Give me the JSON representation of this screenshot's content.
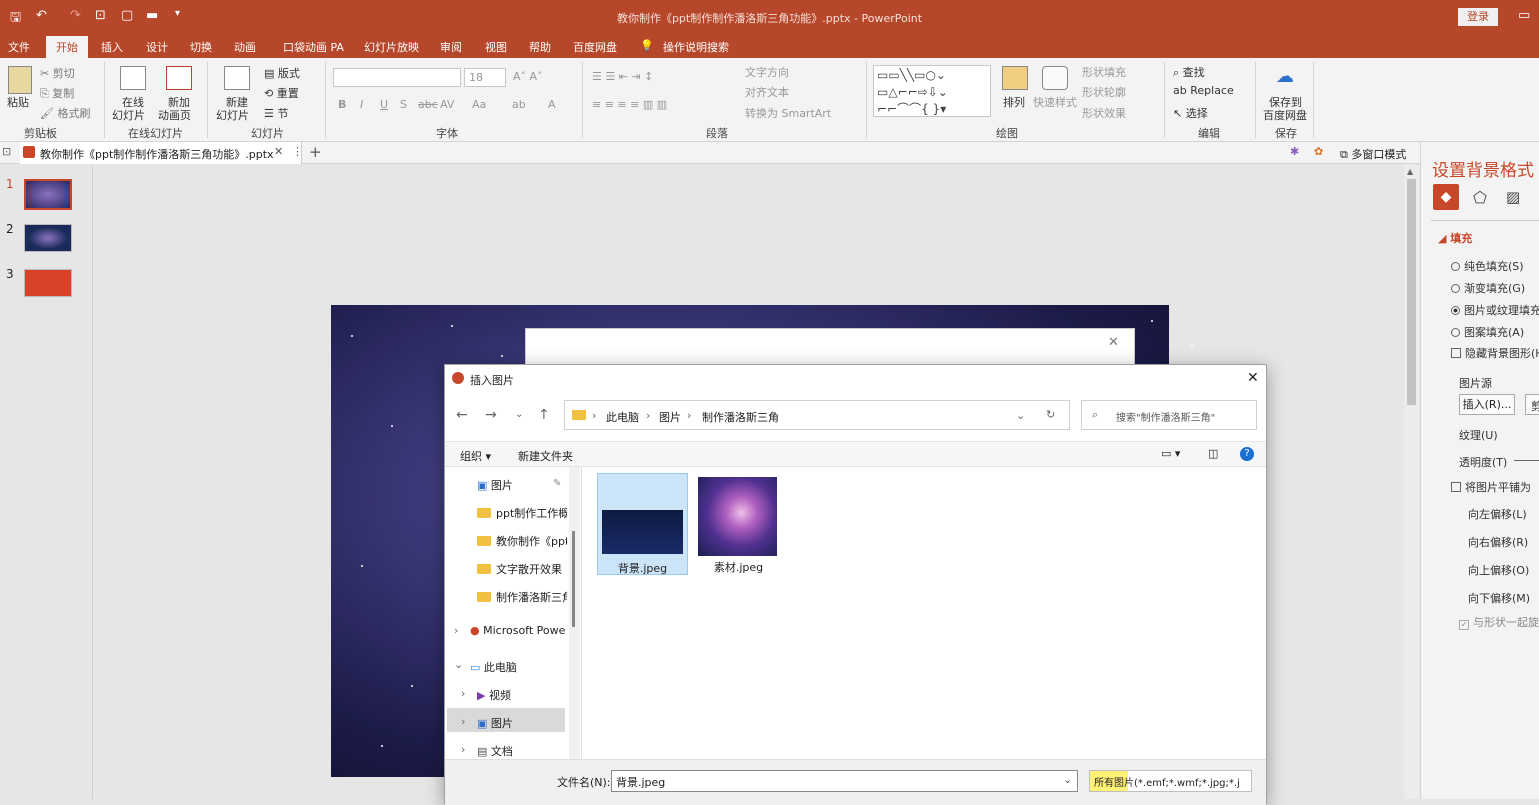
{
  "window": {
    "title": "教你制作《ppt制作制作潘洛斯三角功能》.pptx  -  PowerPoint",
    "login": "登录"
  },
  "menu": [
    "文件",
    "开始",
    "插入",
    "设计",
    "切换",
    "动画",
    "口袋动画 PA",
    "幻灯片放映",
    "审阅",
    "视图",
    "帮助",
    "百度网盘"
  ],
  "menu_search": "操作说明搜索",
  "ribbon": {
    "paste": "粘贴",
    "cut": "剪切",
    "copy": "复制",
    "format_painter": "格式刷",
    "group_clipboard": "剪贴板",
    "online_slide_1": "在线",
    "online_slide_2": "幻灯片",
    "new_anim_1": "新加",
    "new_anim_2": "动画页",
    "group_online": "在线幻灯片",
    "new_slide_1": "新建",
    "new_slide_2": "幻灯片",
    "layout": "版式",
    "reset": "重置",
    "section": "节",
    "group_slides": "幻灯片",
    "font_size": "18",
    "group_font": "字体",
    "text_direction": "文字方向",
    "align_text": "对齐文本",
    "smartart": "转换为 SmartArt",
    "group_paragraph": "段落",
    "arrange": "排列",
    "quick_style": "快速样式",
    "shape_fill": "形状填充",
    "shape_outline": "形状轮廓",
    "shape_effect": "形状效果",
    "group_drawing": "绘图",
    "find": "查找",
    "replace": "Replace",
    "select": "选择",
    "group_editing": "编辑",
    "save_baidu_1": "保存到",
    "save_baidu_2": "百度网盘",
    "group_save": "保存"
  },
  "doctab": {
    "name": "教你制作《ppt制作制作潘洛斯三角功能》.pptx",
    "multiwindow": "多窗口模式"
  },
  "slides": [
    {
      "num": "1"
    },
    {
      "num": "2"
    },
    {
      "num": "3"
    }
  ],
  "format_panel": {
    "title": "设置背景格式",
    "fill": "填充",
    "solid": "纯色填充(S)",
    "gradient": "渐变填充(G)",
    "picture": "图片或纹理填充",
    "pattern": "图案填充(A)",
    "hide": "隐藏背景图形(H",
    "source": "图片源",
    "insert": "插入(R)...",
    "insert2": "剪",
    "texture": "纹理(U)",
    "transparency": "透明度(T)",
    "tile": "将图片平铺为",
    "left": "向左偏移(L)",
    "right": "向右偏移(R)",
    "up": "向上偏移(O)",
    "down": "向下偏移(M)",
    "rotate": "与形状一起旋"
  },
  "dialog": {
    "title": "插入图片",
    "breadcrumb": [
      "此电脑",
      "图片",
      "制作潘洛斯三角"
    ],
    "search_placeholder": "搜索\"制作潘洛斯三角\"",
    "organize": "组织",
    "new_folder": "新建文件夹",
    "tree": [
      "图片",
      "ppt制作工作概",
      "教你制作《ppt",
      "文字散开效果",
      "制作潘洛斯三角",
      "Microsoft Powe",
      "此电脑",
      "视频",
      "图片",
      "文档"
    ],
    "files": [
      {
        "name": "背景.jpeg"
      },
      {
        "name": "素材.jpeg"
      }
    ],
    "filename_label": "文件名(N):",
    "filename": "背景.jpeg",
    "filetype": "所有图片(*.emf;*.wmf;*.jpg;*.j"
  }
}
